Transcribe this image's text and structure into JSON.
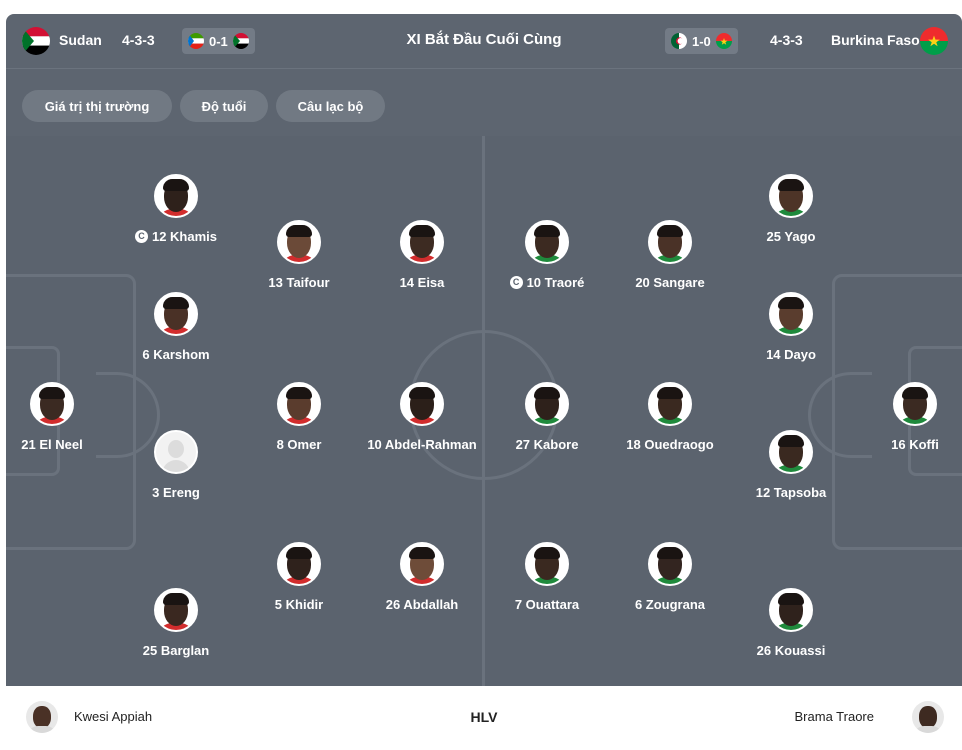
{
  "header": {
    "title": "XI Bắt Đầu Cuối Cùng",
    "home": {
      "team": "Sudan",
      "formation": "4-3-3",
      "last_result": "0-1",
      "flag_icon": "sudan-flag-icon"
    },
    "away": {
      "team": "Burkina Faso",
      "formation": "4-3-3",
      "last_result": "1-0",
      "flag_icon": "burkina-faso-flag-icon"
    }
  },
  "filters": [
    "Giá trị thị trường",
    "Độ tuổi",
    "Câu lạc bộ"
  ],
  "captain_mark": "C",
  "home_players": [
    {
      "label": "21 El Neel",
      "skin": "#3b2a22",
      "shirt": "#d22d2d",
      "captain": false
    },
    {
      "label": "12 Khamis",
      "skin": "#2e211b",
      "shirt": "#d22d2d",
      "captain": true
    },
    {
      "label": "6 Karshom",
      "skin": "#4a3126",
      "shirt": "#d22d2d",
      "captain": false
    },
    {
      "label": "3 Ereng",
      "skin": "",
      "shirt": "",
      "captain": false,
      "blank": true
    },
    {
      "label": "25 Barglan",
      "skin": "#3a2820",
      "shirt": "#d22d2d",
      "captain": false
    },
    {
      "label": "13 Taifour",
      "skin": "#6b4a38",
      "shirt": "#d22d2d",
      "captain": false
    },
    {
      "label": "8 Omer",
      "skin": "#5a3c2d",
      "shirt": "#d22d2d",
      "captain": false
    },
    {
      "label": "5 Khidir",
      "skin": "#2f221c",
      "shirt": "#d22d2d",
      "captain": false
    },
    {
      "label": "14 Eisa",
      "skin": "#3d2b22",
      "shirt": "#d22d2d",
      "captain": false
    },
    {
      "label": "10 Abdel-Rahman",
      "skin": "#2b1f19",
      "shirt": "#d22d2d",
      "captain": false
    },
    {
      "label": "26 Abdallah",
      "skin": "#6e4c39",
      "shirt": "#d22d2d",
      "captain": false
    }
  ],
  "away_players": [
    {
      "label": "16 Koffi",
      "skin": "#3b2a22",
      "shirt": "#1f8a3c",
      "captain": false
    },
    {
      "label": "25 Yago",
      "skin": "#4d3427",
      "shirt": "#1f8a3c",
      "captain": false
    },
    {
      "label": "14 Dayo",
      "skin": "#5a3d2e",
      "shirt": "#1f8a3c",
      "captain": false
    },
    {
      "label": "12 Tapsoba",
      "skin": "#3a2920",
      "shirt": "#1f8a3c",
      "captain": false
    },
    {
      "label": "26 Kouassi",
      "skin": "#2f221c",
      "shirt": "#1f8a3c",
      "captain": false
    },
    {
      "label": "20 Sangare",
      "skin": "#4a3227",
      "shirt": "#1f8a3c",
      "captain": false
    },
    {
      "label": "18 Ouedraogo",
      "skin": "#3a2920",
      "shirt": "#1f8a3c",
      "captain": false
    },
    {
      "label": "6 Zougrana",
      "skin": "#332520",
      "shirt": "#1f8a3c",
      "captain": false
    },
    {
      "label": "10 Traoré",
      "skin": "#3c2a21",
      "shirt": "#1f8a3c",
      "captain": true
    },
    {
      "label": "27 Kabore",
      "skin": "#2e211b",
      "shirt": "#1f8a3c",
      "captain": false
    },
    {
      "label": "7 Ouattara",
      "skin": "#3a2920",
      "shirt": "#1f8a3c",
      "captain": false
    }
  ],
  "coaches": {
    "home": "Kwesi Appiah",
    "label": "HLV",
    "away": "Brama Traore"
  },
  "colors": {
    "pitch": "#5b636e",
    "header": "#5d6570",
    "chip": "#717983"
  }
}
